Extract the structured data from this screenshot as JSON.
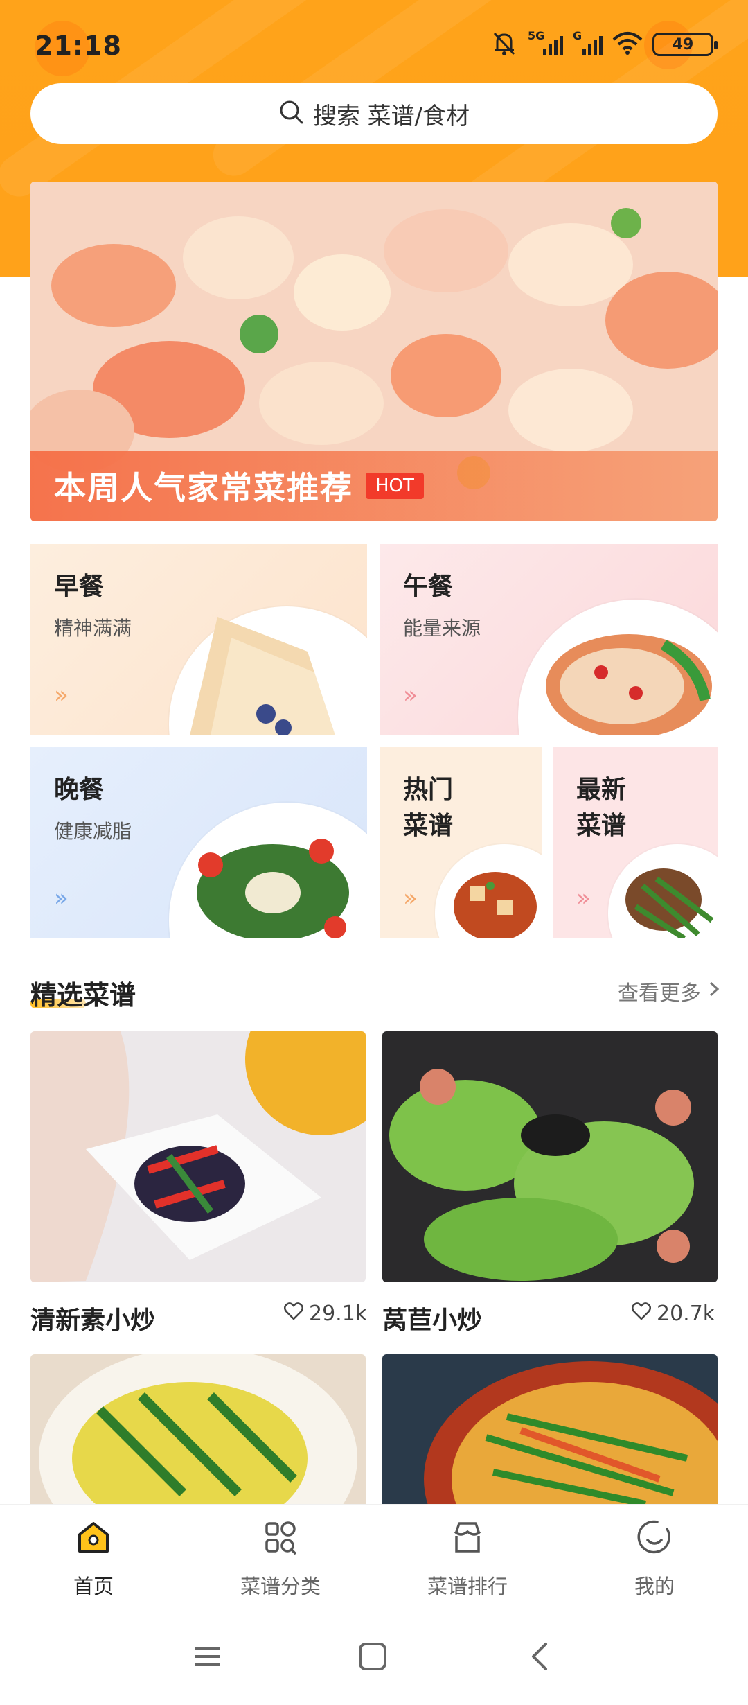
{
  "status_bar": {
    "time": "21:18",
    "network_1": "5G",
    "network_2": "G",
    "battery": "49"
  },
  "search": {
    "placeholder": "搜索 菜谱/食材"
  },
  "banner": {
    "caption": "本周人气家常菜推荐",
    "badge": "HOT"
  },
  "meals": [
    {
      "title": "早餐",
      "subtitle": "精神满满",
      "accent": "#f5a86a"
    },
    {
      "title": "午餐",
      "subtitle": "能量来源",
      "accent": "#f08d96"
    },
    {
      "title": "晚餐",
      "subtitle": "健康减脂",
      "accent": "#79a8e8"
    },
    {
      "title": "热门\n菜谱",
      "accent": "#f5a86a"
    },
    {
      "title": "最新\n菜谱",
      "accent": "#f08d96"
    }
  ],
  "featured": {
    "title": "精选菜谱",
    "see_more": "查看更多"
  },
  "recipes": [
    {
      "name": "清新素小炒",
      "likes": "29.1k"
    },
    {
      "name": "莴苣小炒",
      "likes": "20.7k"
    }
  ],
  "bottom_nav": [
    {
      "label": "首页",
      "icon": "home-icon",
      "active": true
    },
    {
      "label": "菜谱分类",
      "icon": "category-icon",
      "active": false
    },
    {
      "label": "菜谱排行",
      "icon": "ranking-icon",
      "active": false
    },
    {
      "label": "我的",
      "icon": "profile-icon",
      "active": false
    }
  ],
  "colors": {
    "brand": "#ffa31a",
    "hot_badge": "#f23a2a"
  }
}
